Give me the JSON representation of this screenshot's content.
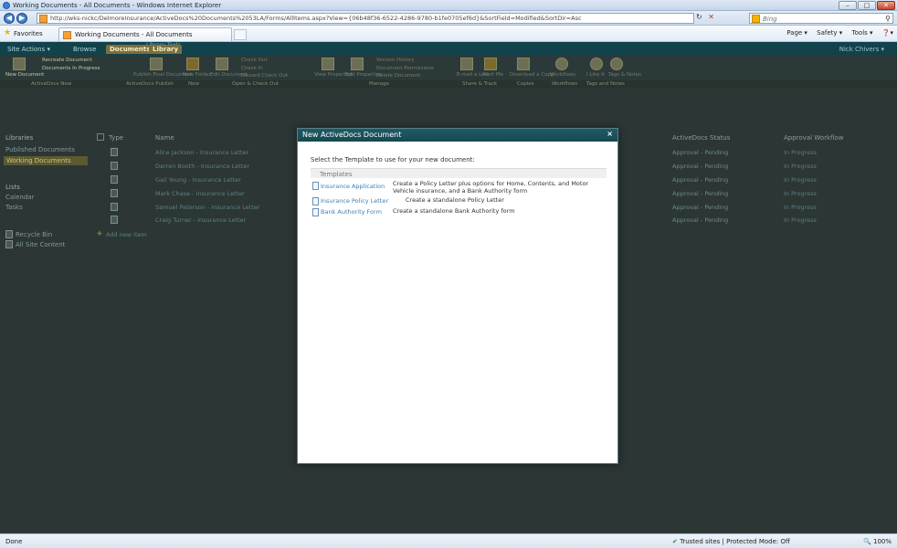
{
  "window": {
    "title": "Working Documents - All Documents - Windows Internet Explorer",
    "minimize": "–",
    "maximize": "□",
    "close": "✕"
  },
  "address_bar": {
    "url": "http://wks-nickc/DelmoreInsurance/ActiveDocs%20Documents%2053LA/Forms/AllItems.aspx?View={06b48f36-6522-4286-9780-b1fe0705ef6d}&SortField=Modified&SortDir=Asc",
    "back": "◀",
    "forward": "▶",
    "refresh": "↻",
    "stop": "✕",
    "search_placeholder": "Bing",
    "search_glyph": "⚲"
  },
  "favorites_bar": {
    "favorites_label": "Favorites",
    "tab_label": "Working Documents - All Documents",
    "commands": [
      "Page ▾",
      "Safety ▾",
      "Tools ▾",
      "❓▾"
    ]
  },
  "ribbon": {
    "site_actions": "Site Actions ▾",
    "browse_tab": "Browse",
    "documents_tab": "Documents",
    "library_tab": "Library",
    "library_tools": "Library Tools",
    "user": "Nick Chivers ▾",
    "buttons": {
      "new_document": "New Document",
      "recreate": "Recreate Document",
      "documents_in_progress": "Documents In Progress",
      "publish_final": "Publish Final Document",
      "new_folder": "New Folder",
      "edit_document": "Edit Document",
      "check_out": "Check Out",
      "check_in": "Check In",
      "discard_check_out": "Discard Check Out",
      "view_properties": "View Properties",
      "edit_properties": "Edit Properties",
      "version_history": "Version History",
      "document_permissions": "Document Permissions",
      "delete_document": "Delete Document",
      "email_link": "E-mail a Link",
      "alert_me": "Alert Me",
      "download_copy": "Download a Copy",
      "workflows": "Workflows",
      "i_like_it": "I Like It",
      "tags_notes": "Tags & Notes"
    },
    "groups": {
      "activedocs_new": "ActiveDocs New",
      "activedocs_publish": "ActiveDocs Publish",
      "new": "New",
      "open_check_out": "Open & Check Out",
      "manage": "Manage",
      "share_track": "Share & Track",
      "copies": "Copies",
      "workflows": "Workflows",
      "tags_notes": "Tags and Notes"
    }
  },
  "left_nav": {
    "libraries": "Libraries",
    "published_documents": "Published Documents",
    "working_documents": "Working Documents",
    "lists": "Lists",
    "calendar": "Calendar",
    "tasks": "Tasks",
    "recycle_bin": "Recycle Bin",
    "all_site_content": "All Site Content"
  },
  "list": {
    "headers": {
      "type": "Type",
      "name": "Name",
      "activedocs_status": "ActiveDocs Status",
      "approval_workflow": "Approval Workflow"
    },
    "rows": [
      {
        "name": "Alice Jackson - Insurance Letter",
        "status": "Approval - Pending",
        "workflow": "In Progress"
      },
      {
        "name": "Darren Booth - Insurance Letter",
        "status": "Approval - Pending",
        "workflow": "In Progress"
      },
      {
        "name": "Gail Young - Insurance Letter",
        "status": "Approval - Pending",
        "workflow": "In Progress"
      },
      {
        "name": "Mark Chase - Insurance Letter",
        "status": "Approval - Pending",
        "workflow": "In Progress"
      },
      {
        "name": "Samuel Peterson - Insurance Letter",
        "status": "Approval - Pending",
        "workflow": "In Progress"
      },
      {
        "name": "Craig Turner - Insurance Letter",
        "status": "Approval - Pending",
        "workflow": "In Progress"
      }
    ],
    "add_new_item": "Add new item"
  },
  "dialog": {
    "title": "New ActiveDocs Document",
    "close": "×",
    "prompt": "Select the Template to use for your new document:",
    "templates_header": "Templates",
    "templates": [
      {
        "name": "Insurance Application",
        "description": "Create a Policy Letter plus options for Home, Contents, and Motor Vehicle insurance, and a Bank Authority form"
      },
      {
        "name": "Insurance Policy Letter",
        "description": "Create a standalone Policy Letter"
      },
      {
        "name": "Bank Authority Form",
        "description": "Create a standalone Bank Authority form"
      }
    ]
  },
  "status_bar": {
    "done": "Done",
    "zone": "Trusted sites | Protected Mode: Off",
    "zoom": "100%"
  }
}
